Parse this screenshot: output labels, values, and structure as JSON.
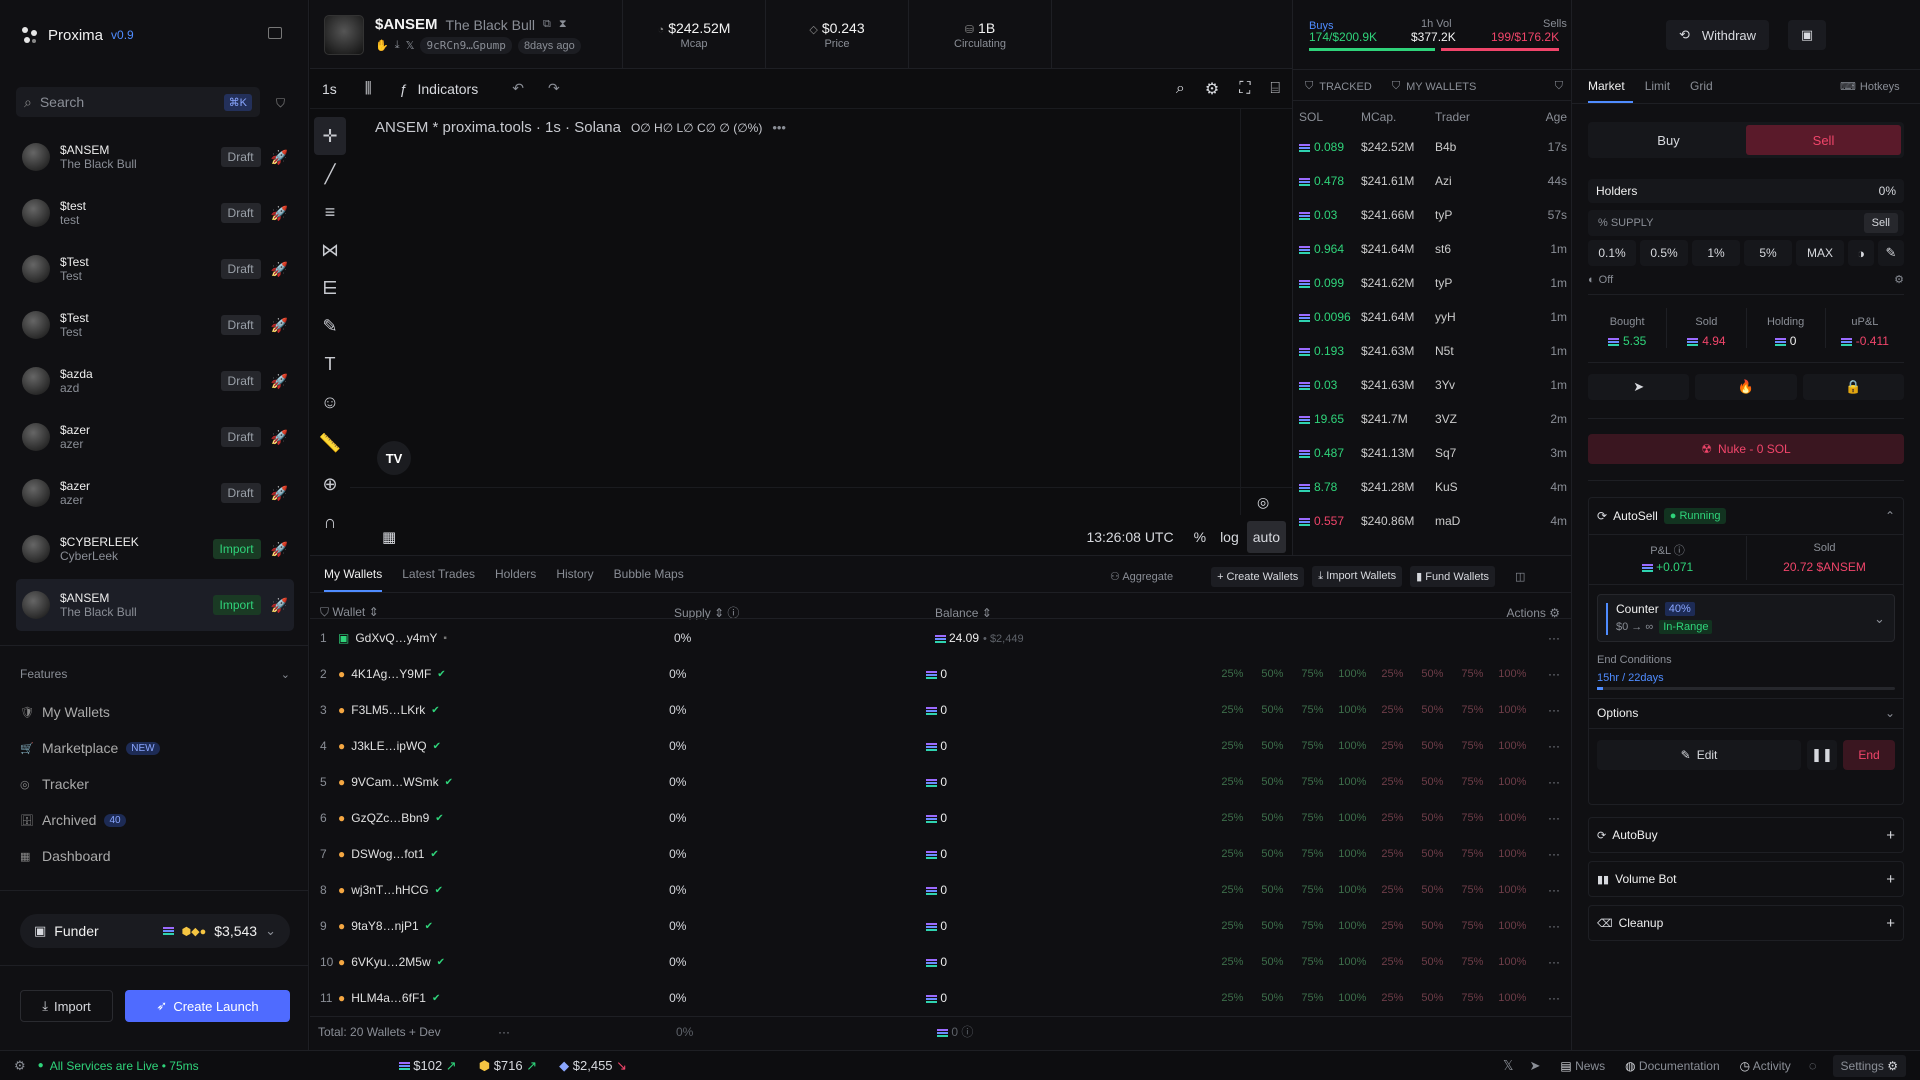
{
  "app": {
    "name": "Proxima",
    "version": "v0.9"
  },
  "search": {
    "placeholder": "Search",
    "shortcut": "⌘K"
  },
  "tokens": [
    {
      "ticker": "$ANSEM",
      "name": "The Black Bull",
      "action": "Draft"
    },
    {
      "ticker": "$test",
      "name": "test",
      "action": "Draft"
    },
    {
      "ticker": "$Test",
      "name": "Test",
      "action": "Draft"
    },
    {
      "ticker": "$Test",
      "name": "Test",
      "action": "Draft"
    },
    {
      "ticker": "$azda",
      "name": "azd",
      "action": "Draft"
    },
    {
      "ticker": "$azer",
      "name": "azer",
      "action": "Draft"
    },
    {
      "ticker": "$azer",
      "name": "azer",
      "action": "Draft"
    },
    {
      "ticker": "$CYBERLEEK",
      "name": "CyberLeek",
      "action": "Import"
    },
    {
      "ticker": "$ANSEM",
      "name": "The Black Bull",
      "action": "Import"
    }
  ],
  "features": {
    "title": "Features",
    "items": [
      {
        "label": "My Wallets",
        "badge": ""
      },
      {
        "label": "Marketplace",
        "badge": "NEW"
      },
      {
        "label": "Tracker",
        "badge": ""
      },
      {
        "label": "Archived",
        "badge": "40"
      },
      {
        "label": "Dashboard",
        "badge": ""
      }
    ]
  },
  "funder": {
    "label": "Funder",
    "amount": "$3,543"
  },
  "sidebar_buttons": {
    "import": "Import",
    "create": "Create Launch"
  },
  "header": {
    "ticker": "$ANSEM",
    "name": "The Black Bull",
    "address": "9cRCn9…Gpump",
    "age": "8days ago",
    "stats": [
      {
        "value": "$242.52M",
        "label": "Mcap"
      },
      {
        "value": "$0.243",
        "label": "Price"
      },
      {
        "value": "1B",
        "label": "Circulating"
      }
    ],
    "buys_label": "Buys",
    "buys": "174/$200.9K",
    "vol_label": "1h Vol",
    "vol": "$377.2K",
    "sells_label": "Sells",
    "sells_count": "199",
    "sells_amount": "/$176.2K"
  },
  "chart_toolbar": {
    "interval": "1s",
    "indicators": "Indicators"
  },
  "chart": {
    "legend": "ANSEM * proxima.tools · 1s · Solana",
    "ohlc": "O∅ H∅ L∅ C∅ ∅ (∅%)",
    "time": "13:26:08 UTC",
    "pct": "%",
    "log": "log",
    "auto": "auto"
  },
  "trades": {
    "filters": {
      "tracked": "TRACKED",
      "wallets": "MY WALLETS"
    },
    "headers": [
      "SOL",
      "MCap.",
      "Trader",
      "Age"
    ],
    "rows": [
      {
        "sol": "0.089",
        "mcap": "$242.52M",
        "trader": "B4b",
        "age": "17s",
        "side": "buy"
      },
      {
        "sol": "0.478",
        "mcap": "$241.61M",
        "trader": "Azi",
        "age": "44s",
        "side": "buy"
      },
      {
        "sol": "0.03",
        "mcap": "$241.66M",
        "trader": "tyP",
        "age": "57s",
        "side": "buy"
      },
      {
        "sol": "0.964",
        "mcap": "$241.64M",
        "trader": "st6",
        "age": "1m",
        "side": "buy"
      },
      {
        "sol": "0.099",
        "mcap": "$241.62M",
        "trader": "tyP",
        "age": "1m",
        "side": "buy"
      },
      {
        "sol": "0.0096",
        "mcap": "$241.64M",
        "trader": "yyH",
        "age": "1m",
        "side": "buy"
      },
      {
        "sol": "0.193",
        "mcap": "$241.63M",
        "trader": "N5t",
        "age": "1m",
        "side": "buy"
      },
      {
        "sol": "0.03",
        "mcap": "$241.63M",
        "trader": "3Yv",
        "age": "1m",
        "side": "buy"
      },
      {
        "sol": "19.65",
        "mcap": "$241.7M",
        "trader": "3VZ",
        "age": "2m",
        "side": "buy"
      },
      {
        "sol": "0.487",
        "mcap": "$241.13M",
        "trader": "Sq7",
        "age": "3m",
        "side": "buy"
      },
      {
        "sol": "8.78",
        "mcap": "$241.28M",
        "trader": "KuS",
        "age": "4m",
        "side": "buy"
      },
      {
        "sol": "0.557",
        "mcap": "$240.86M",
        "trader": "maD",
        "age": "4m",
        "side": "sell"
      }
    ]
  },
  "bottom_tabs": [
    "My Wallets",
    "Latest Trades",
    "Holders",
    "History",
    "Bubble Maps"
  ],
  "bottom_actions": {
    "aggregate": "Aggregate",
    "create": "+ Create Wallets",
    "import": "Import Wallets",
    "fund": "Fund Wallets"
  },
  "wallet_headers": {
    "wallet": "Wallet",
    "supply": "Supply",
    "balance": "Balance",
    "actions": "Actions"
  },
  "wallets": [
    {
      "n": "1",
      "addr": "GdXvQ…y4mY",
      "supply": "0%",
      "bal": "24.09",
      "usd": "• $2,449"
    },
    {
      "n": "2",
      "addr": "4K1Ag…Y9MF",
      "supply": "0%",
      "bal": "0",
      "usd": ""
    },
    {
      "n": "3",
      "addr": "F3LM5…LKrk",
      "supply": "0%",
      "bal": "0",
      "usd": ""
    },
    {
      "n": "4",
      "addr": "J3kLE…ipWQ",
      "supply": "0%",
      "bal": "0",
      "usd": ""
    },
    {
      "n": "5",
      "addr": "9VCam…WSmk",
      "supply": "0%",
      "bal": "0",
      "usd": ""
    },
    {
      "n": "6",
      "addr": "GzQZc…Bbn9",
      "supply": "0%",
      "bal": "0",
      "usd": ""
    },
    {
      "n": "7",
      "addr": "DSWog…fot1",
      "supply": "0%",
      "bal": "0",
      "usd": ""
    },
    {
      "n": "8",
      "addr": "wj3nT…hHCG",
      "supply": "0%",
      "bal": "0",
      "usd": ""
    },
    {
      "n": "9",
      "addr": "9taY8…njP1",
      "supply": "0%",
      "bal": "0",
      "usd": ""
    },
    {
      "n": "10",
      "addr": "6VKyu…2M5w",
      "supply": "0%",
      "bal": "0",
      "usd": ""
    },
    {
      "n": "11",
      "addr": "HLM4a…6fF1",
      "supply": "0%",
      "bal": "0",
      "usd": ""
    }
  ],
  "quick_pcts": [
    "25%",
    "50%",
    "75%",
    "100%",
    "25%",
    "50%",
    "75%",
    "100%"
  ],
  "wallet_total": {
    "label": "Total: 20 Wallets + Dev",
    "supply": "0%",
    "bal": "0"
  },
  "right": {
    "tabs": [
      "Market",
      "Limit",
      "Grid"
    ],
    "hotkeys": "Hotkeys",
    "buy": "Buy",
    "sell": "Sell",
    "holders": "Holders",
    "holders_pct": "0%",
    "supply_label": "% SUPPLY",
    "sell_small": "Sell",
    "pcts": [
      "0.1%",
      "0.5%",
      "1%",
      "5%",
      "MAX"
    ],
    "off": "Off",
    "stats": [
      {
        "label": "Bought",
        "value": "5.35"
      },
      {
        "label": "Sold",
        "value": "4.94"
      },
      {
        "label": "Holding",
        "value": "0"
      },
      {
        "label": "uP&L",
        "value": "-0.411"
      }
    ],
    "nuke": "Nuke - 0 SOL",
    "autosell": {
      "title": "AutoSell",
      "status": "Running",
      "pnl_label": "P&L",
      "pnl": "+0.071",
      "sold_label": "Sold",
      "sold": "20.72 $ANSEM",
      "counter": "Counter",
      "counter_pct": "40%",
      "range": "$0 → ∞",
      "in_range": "In-Range",
      "end_title": "End Conditions",
      "end_value": "15hr / 22days",
      "options": "Options",
      "edit": "Edit",
      "end": "End"
    },
    "sections": [
      "AutoBuy",
      "Volume Bot",
      "Cleanup"
    ]
  },
  "footer": {
    "status": "All Services are Live • 75ms",
    "p1": "$102",
    "p2": "$716",
    "p3": "$2,455",
    "news": "News",
    "docs": "Documentation",
    "activity": "Activity",
    "settings": "Settings"
  },
  "colors": {
    "accent": "#4f8cff",
    "green": "#2fd37a",
    "red": "#f0456a",
    "sell_bg": "#5a1a2a"
  }
}
